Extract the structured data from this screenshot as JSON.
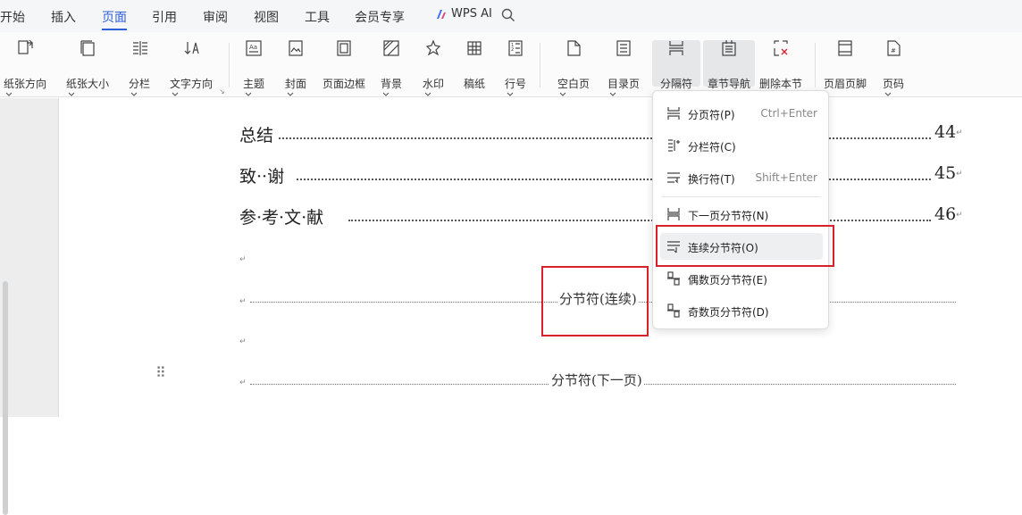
{
  "menu": {
    "items": [
      "开始",
      "插入",
      "页面",
      "引用",
      "审阅",
      "视图",
      "工具",
      "会员专享"
    ],
    "active": "页面",
    "wps_ai": "WPS AI"
  },
  "ribbon": {
    "tools": [
      {
        "label": "纸张方向",
        "icon": "page-orientation-icon",
        "dropdown": true
      },
      {
        "label": "纸张大小",
        "icon": "page-size-icon",
        "dropdown": true
      },
      {
        "label": "分栏",
        "icon": "columns-icon",
        "dropdown": true
      },
      {
        "label": "文字方向",
        "icon": "text-direction-icon",
        "dropdown": true
      },
      {
        "label": "主题",
        "icon": "theme-icon",
        "dropdown": true
      },
      {
        "label": "封面",
        "icon": "cover-icon",
        "dropdown": true
      },
      {
        "label": "页面边框",
        "icon": "page-border-icon",
        "dropdown": false
      },
      {
        "label": "背景",
        "icon": "background-icon",
        "dropdown": true
      },
      {
        "label": "水印",
        "icon": "watermark-icon",
        "dropdown": true
      },
      {
        "label": "稿纸",
        "icon": "manuscript-icon",
        "dropdown": false
      },
      {
        "label": "行号",
        "icon": "line-number-icon",
        "dropdown": true
      },
      {
        "label": "空白页",
        "icon": "blank-page-icon",
        "dropdown": true
      },
      {
        "label": "目录页",
        "icon": "toc-page-icon",
        "dropdown": true
      },
      {
        "label": "分隔符",
        "icon": "separator-icon",
        "dropdown": true,
        "expanded": true
      },
      {
        "label": "章节导航",
        "icon": "section-nav-icon",
        "dropdown": false,
        "highlighted": true
      },
      {
        "label": "删除本节",
        "icon": "delete-section-icon",
        "dropdown": false
      },
      {
        "label": "页眉页脚",
        "icon": "header-footer-icon",
        "dropdown": false
      },
      {
        "label": "页码",
        "icon": "page-number-icon",
        "dropdown": true
      }
    ]
  },
  "document": {
    "toc_entries": [
      {
        "title": "总结",
        "page": "44"
      },
      {
        "title": "致··谢",
        "page": "45"
      },
      {
        "title": "参·考·文·献",
        "page": "46"
      }
    ],
    "para_mark": "↵",
    "section_break_continuous": "分节符(连续)",
    "section_break_next_page": "分节符(下一页)"
  },
  "dropdown": {
    "items": [
      {
        "label": "分页符(P)",
        "shortcut": "Ctrl+Enter",
        "icon": "page-break-icon"
      },
      {
        "label": "分栏符(C)",
        "shortcut": "",
        "icon": "column-break-icon"
      },
      {
        "label": "换行符(T)",
        "shortcut": "Shift+Enter",
        "icon": "line-break-icon"
      },
      {
        "label": "下一页分节符(N)",
        "shortcut": "",
        "icon": "next-page-section-break-icon"
      },
      {
        "label": "连续分节符(O)",
        "shortcut": "",
        "icon": "continuous-section-break-icon",
        "hovered": true
      },
      {
        "label": "偶数页分节符(E)",
        "shortcut": "",
        "icon": "even-page-section-break-icon"
      },
      {
        "label": "奇数页分节符(D)",
        "shortcut": "",
        "icon": "odd-page-section-break-icon"
      }
    ]
  },
  "colors": {
    "accent": "#2f5fd8",
    "annotation": "#d6232b"
  }
}
